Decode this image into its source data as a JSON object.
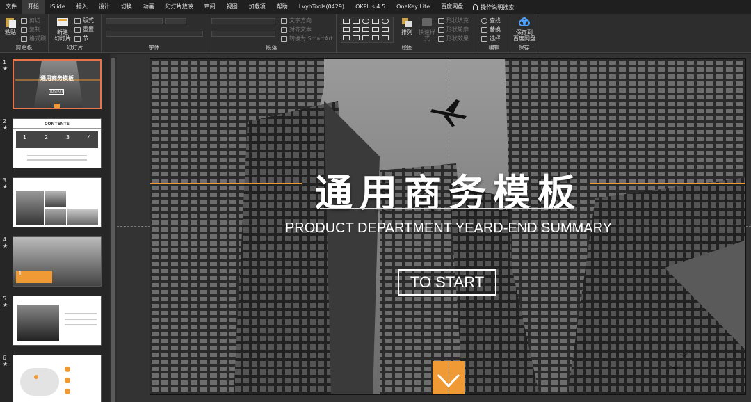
{
  "menu": {
    "tabs": [
      "文件",
      "开始",
      "iSlide",
      "插入",
      "设计",
      "切换",
      "动画",
      "幻灯片放映",
      "审阅",
      "视图",
      "加载项",
      "帮助",
      "LvyhTools(0429)",
      "OKPlus 4.5",
      "OneKey Lite",
      "百度网盘"
    ],
    "active_tab": "开始",
    "tell_me": "操作说明搜索"
  },
  "ribbon": {
    "clipboard": {
      "label": "剪贴板",
      "paste": "粘贴",
      "cut": "剪切",
      "copy": "复制",
      "format_painter": "格式刷"
    },
    "slides": {
      "label": "幻灯片",
      "new_slide_line1": "新建",
      "new_slide_line2": "幻灯片",
      "layout": "版式",
      "reset": "重置",
      "section": "节"
    },
    "font": {
      "label": "字体"
    },
    "paragraph": {
      "label": "段落",
      "text_direction": "文字方向",
      "align_text": "对齐文本",
      "smartart": "转换为 SmartArt"
    },
    "drawing": {
      "label": "绘图",
      "arrange": "排列",
      "quick_styles": "快速样式",
      "shape_fill": "形状填充",
      "shape_outline": "形状轮廓",
      "shape_effects": "形状效果"
    },
    "editing": {
      "label": "编辑",
      "find": "查找",
      "replace": "替换",
      "select": "选择"
    },
    "save": {
      "label": "保存",
      "save_to_line1": "保存到",
      "save_to_line2": "百度网盘"
    }
  },
  "thumbnails": [
    {
      "num": "1",
      "star": "★",
      "title": "通用商务模板",
      "sub": "TO START"
    },
    {
      "num": "2",
      "star": "★",
      "title": "CONTENTS",
      "items": [
        "1",
        "2",
        "3",
        "4"
      ]
    },
    {
      "num": "3",
      "star": "★"
    },
    {
      "num": "4",
      "star": "★",
      "badge": "1"
    },
    {
      "num": "5",
      "star": "★"
    },
    {
      "num": "6",
      "star": "★"
    }
  ],
  "slide": {
    "title": "通用商务模板",
    "subtitle": "PRODUCT DEPARTMENT YEARD-END SUMMARY",
    "button": "TO START",
    "accent_color": "#f09a35"
  },
  "colors": {
    "accent": "#f09a35",
    "selection": "#e8744a"
  }
}
